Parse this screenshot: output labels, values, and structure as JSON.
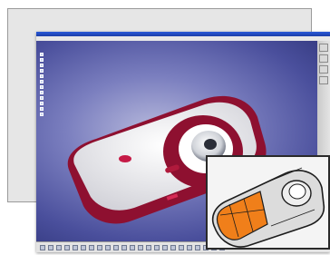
{
  "colors": {
    "viewport_background": "#4a4f9c",
    "camera_body": "#f3f3f3",
    "camera_trim": "#8e1030",
    "inset_highlight": "#f07f1a"
  },
  "icons": [
    "tree-node-icon",
    "toolbar-icon",
    "status-icon",
    "camera-model"
  ]
}
